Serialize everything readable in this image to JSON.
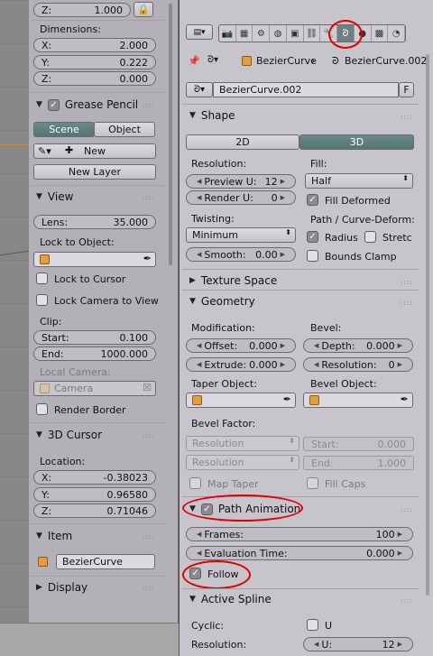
{
  "left": {
    "z_top": {
      "key": "Z:",
      "value": "1.000"
    },
    "lock_icon": "lock-icon",
    "dimensions": {
      "label": "Dimensions:",
      "x_key": "X:",
      "x": "2.000",
      "y_key": "Y:",
      "y": "0.222",
      "z_key": "Z:",
      "z": "0.000"
    },
    "grease": {
      "title": "Grease Pencil",
      "scene": "Scene",
      "object": "Object",
      "new": "New",
      "new_layer": "New Layer"
    },
    "view": {
      "title": "View",
      "lens_key": "Lens:",
      "lens": "35.000",
      "lock_label": "Lock to Object:",
      "lock_cursor": "Lock to Cursor",
      "lock_camera": "Lock Camera to View",
      "clip": "Clip:",
      "start_key": "Start:",
      "start": "0.100",
      "end_key": "End:",
      "end": "1000.000",
      "local_camera": "Local Camera:",
      "camera": "Camera",
      "render_border": "Render Border"
    },
    "cursor": {
      "title": "3D Cursor",
      "location": "Location:",
      "x_key": "X:",
      "x": "-0.38023",
      "y_key": "Y:",
      "y": "0.96580",
      "z_key": "Z:",
      "z": "0.71046"
    },
    "item": {
      "title": "Item",
      "name": "BezierCurve"
    },
    "display": {
      "title": "Display"
    }
  },
  "right": {
    "breadcrumb": {
      "object": "BezierCurve",
      "data": "BezierCurve.002"
    },
    "datablock": {
      "name": "BezierCurve.002",
      "fake": "F"
    },
    "shape": {
      "title": "Shape",
      "tab2d": "2D",
      "tab3d": "3D",
      "resolution": "Resolution:",
      "preview_key": "Preview U:",
      "preview": "12",
      "render_key": "Render U:",
      "render": "0",
      "fill": "Fill:",
      "fill_value": "Half",
      "fill_deformed": "Fill Deformed",
      "twisting": "Twisting:",
      "twisting_value": "Minimum",
      "path_deform": "Path / Curve-Deform:",
      "radius": "Radius",
      "stretch": "Stretc",
      "smooth_key": "Smooth:",
      "smooth": "0.00",
      "bounds_clamp": "Bounds Clamp"
    },
    "texture_space": {
      "title": "Texture Space"
    },
    "geometry": {
      "title": "Geometry",
      "modification": "Modification:",
      "offset_key": "Offset:",
      "offset": "0.000",
      "extrude_key": "Extrude:",
      "extrude": "0.000",
      "bevel": "Bevel:",
      "depth_key": "Depth:",
      "depth": "0.000",
      "res_key": "Resolution:",
      "res": "0",
      "taper": "Taper Object:",
      "bevel_obj": "Bevel Object:",
      "bevel_factor": "Bevel Factor:",
      "bf_res1": "Resolution",
      "bf_start_key": "Start:",
      "bf_start": "0.000",
      "bf_res2": "Resolution",
      "bf_end_key": "End:",
      "bf_end": "1.000",
      "map_taper": "Map Taper",
      "fill_caps": "Fill Caps"
    },
    "path": {
      "title": "Path Animation",
      "frames_key": "Frames:",
      "frames": "100",
      "eval_key": "Evaluation Time:",
      "eval": "0.000",
      "follow": "Follow"
    },
    "spline": {
      "title": "Active Spline",
      "cyclic": "Cyclic:",
      "u": "U",
      "resolution": "Resolution:",
      "u_key": "U:",
      "u_value": "12"
    }
  },
  "colors": {
    "highlight_ring": "#e00000",
    "selected_tab": "#6f7f7f"
  }
}
